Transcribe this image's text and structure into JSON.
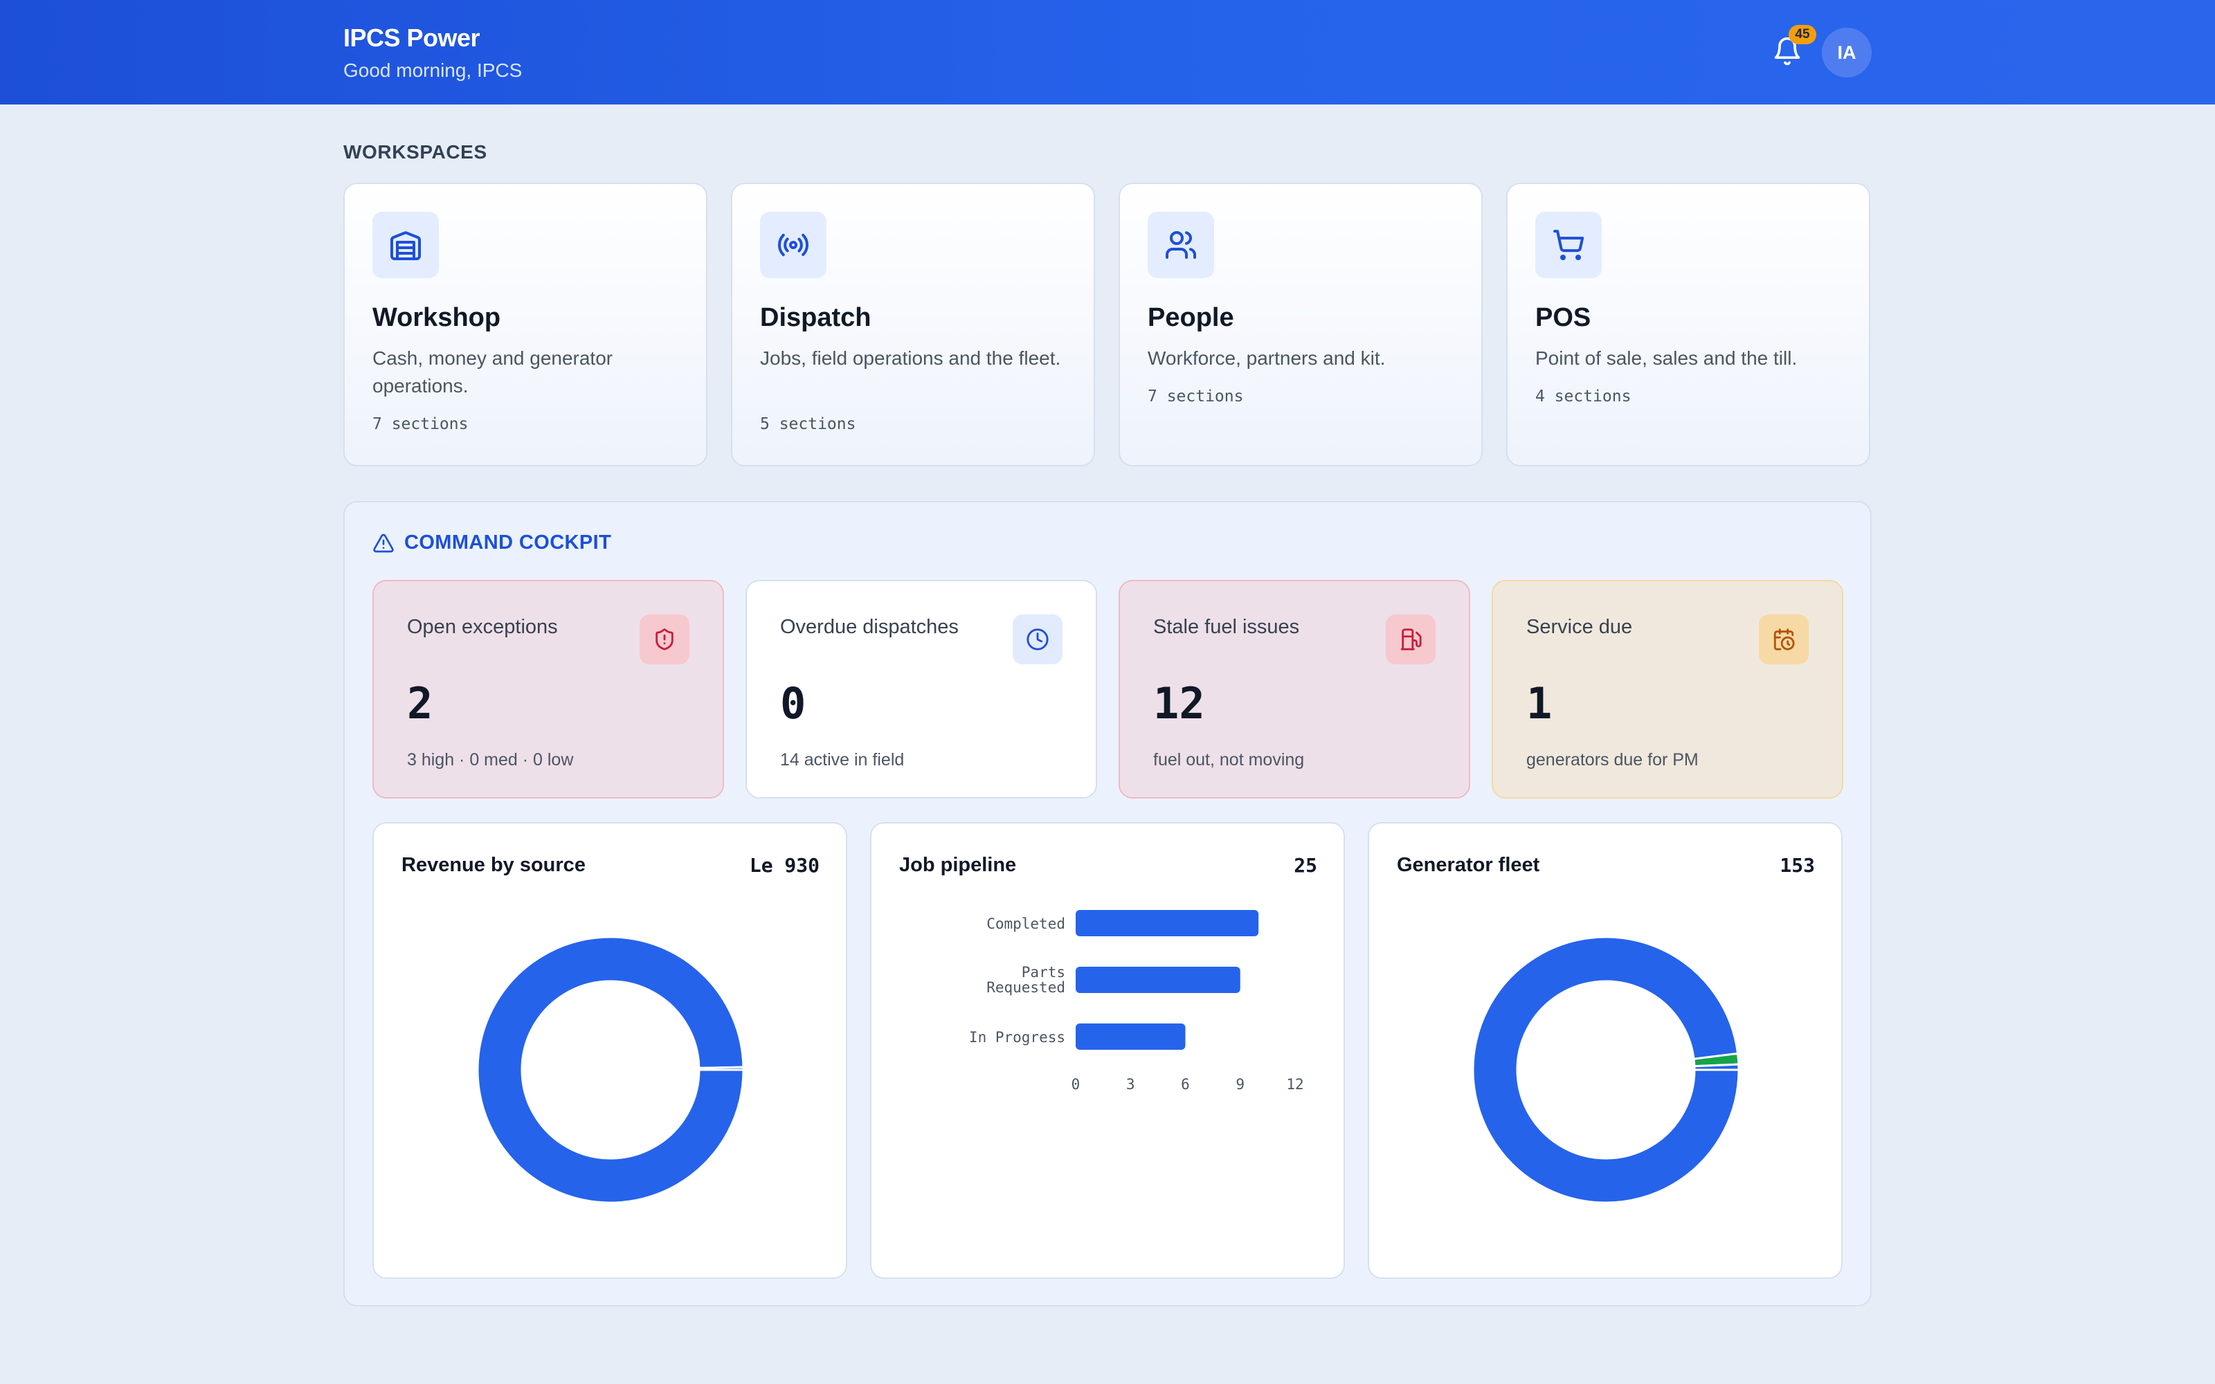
{
  "header": {
    "title": "IPCS Power",
    "greeting": "Good morning, IPCS",
    "notifications_count": "45",
    "avatar_initials": "IA",
    "bell_icon": "bell-icon",
    "colors": {
      "brand": "#2563eb",
      "badge": "#f59e0b"
    }
  },
  "workspaces": {
    "label": "WORKSPACES",
    "items": [
      {
        "title": "Workshop",
        "description": "Cash, money and generator operations.",
        "count": "7 sections",
        "icon": "warehouse-icon"
      },
      {
        "title": "Dispatch",
        "description": "Jobs, field operations and the fleet.",
        "count": "5 sections",
        "icon": "radio-broadcast-icon"
      },
      {
        "title": "People",
        "description": "Workforce, partners and kit.",
        "count": "7 sections",
        "icon": "users-icon"
      },
      {
        "title": "POS",
        "description": "Point of sale, sales and the till.",
        "count": "4 sections",
        "icon": "shopping-cart-icon"
      }
    ]
  },
  "cockpit": {
    "title": "COMMAND COCKPIT",
    "icon": "warning-triangle-icon",
    "kpis": [
      {
        "label": "Open exceptions",
        "value": "2",
        "sub": "3 high · 0 med · 0 low",
        "icon": "shield-alert-icon",
        "tone": "red"
      },
      {
        "label": "Overdue dispatches",
        "value": "0",
        "sub": "14 active in field",
        "icon": "clock-icon",
        "tone": "white"
      },
      {
        "label": "Stale fuel issues",
        "value": "12",
        "sub": "fuel out, not moving",
        "icon": "fuel-pump-icon",
        "tone": "red"
      },
      {
        "label": "Service due",
        "value": "1",
        "sub": "generators due for PM",
        "icon": "calendar-clock-icon",
        "tone": "amber"
      }
    ],
    "charts": {
      "revenue": {
        "title": "Revenue by source",
        "total": "Le 930"
      },
      "pipeline": {
        "title": "Job pipeline",
        "total": "25"
      },
      "fleet": {
        "title": "Generator fleet",
        "total": "153"
      }
    }
  },
  "chart_data": [
    {
      "type": "pie",
      "title": "Revenue by source",
      "slices": [
        {
          "value": 927,
          "color": "#2563eb"
        },
        {
          "value": 3,
          "color": "#2563eb"
        }
      ],
      "donut": true
    },
    {
      "type": "bar",
      "orientation": "horizontal",
      "title": "Job pipeline",
      "categories": [
        "Completed",
        "Parts Requested",
        "In Progress"
      ],
      "values": [
        10,
        9,
        6
      ],
      "xlim": [
        0,
        12
      ],
      "xticks": [
        0,
        3,
        6,
        9,
        12
      ],
      "color": "#2563eb"
    },
    {
      "type": "pie",
      "title": "Generator fleet",
      "slices": [
        {
          "value": 150,
          "color": "#2563eb"
        },
        {
          "value": 2,
          "color": "#16a34a"
        },
        {
          "value": 1,
          "color": "#2563eb"
        }
      ],
      "donut": true
    }
  ]
}
